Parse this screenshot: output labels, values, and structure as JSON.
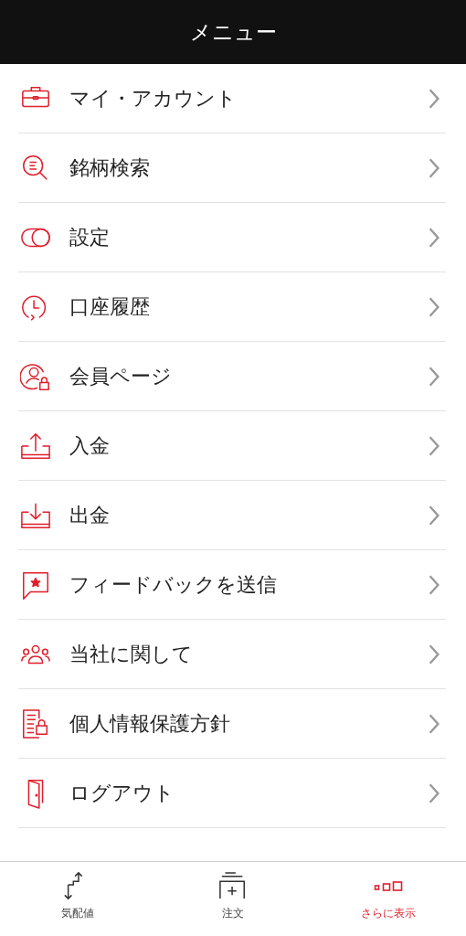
{
  "header": {
    "title": "メニュー"
  },
  "menu_items": [
    {
      "label": "マイ・アカウント"
    },
    {
      "label": "銘柄検索"
    },
    {
      "label": "設定"
    },
    {
      "label": "口座履歴"
    },
    {
      "label": "会員ページ"
    },
    {
      "label": "入金"
    },
    {
      "label": "出金"
    },
    {
      "label": "フィードバックを送信"
    },
    {
      "label": "当社に関して"
    },
    {
      "label": "個人情報保護方針"
    },
    {
      "label": "ログアウト"
    }
  ],
  "tab_bar": [
    {
      "label": "気配値",
      "selected": false
    },
    {
      "label": "注文",
      "selected": false
    },
    {
      "label": "さらに表示",
      "selected": true
    }
  ]
}
